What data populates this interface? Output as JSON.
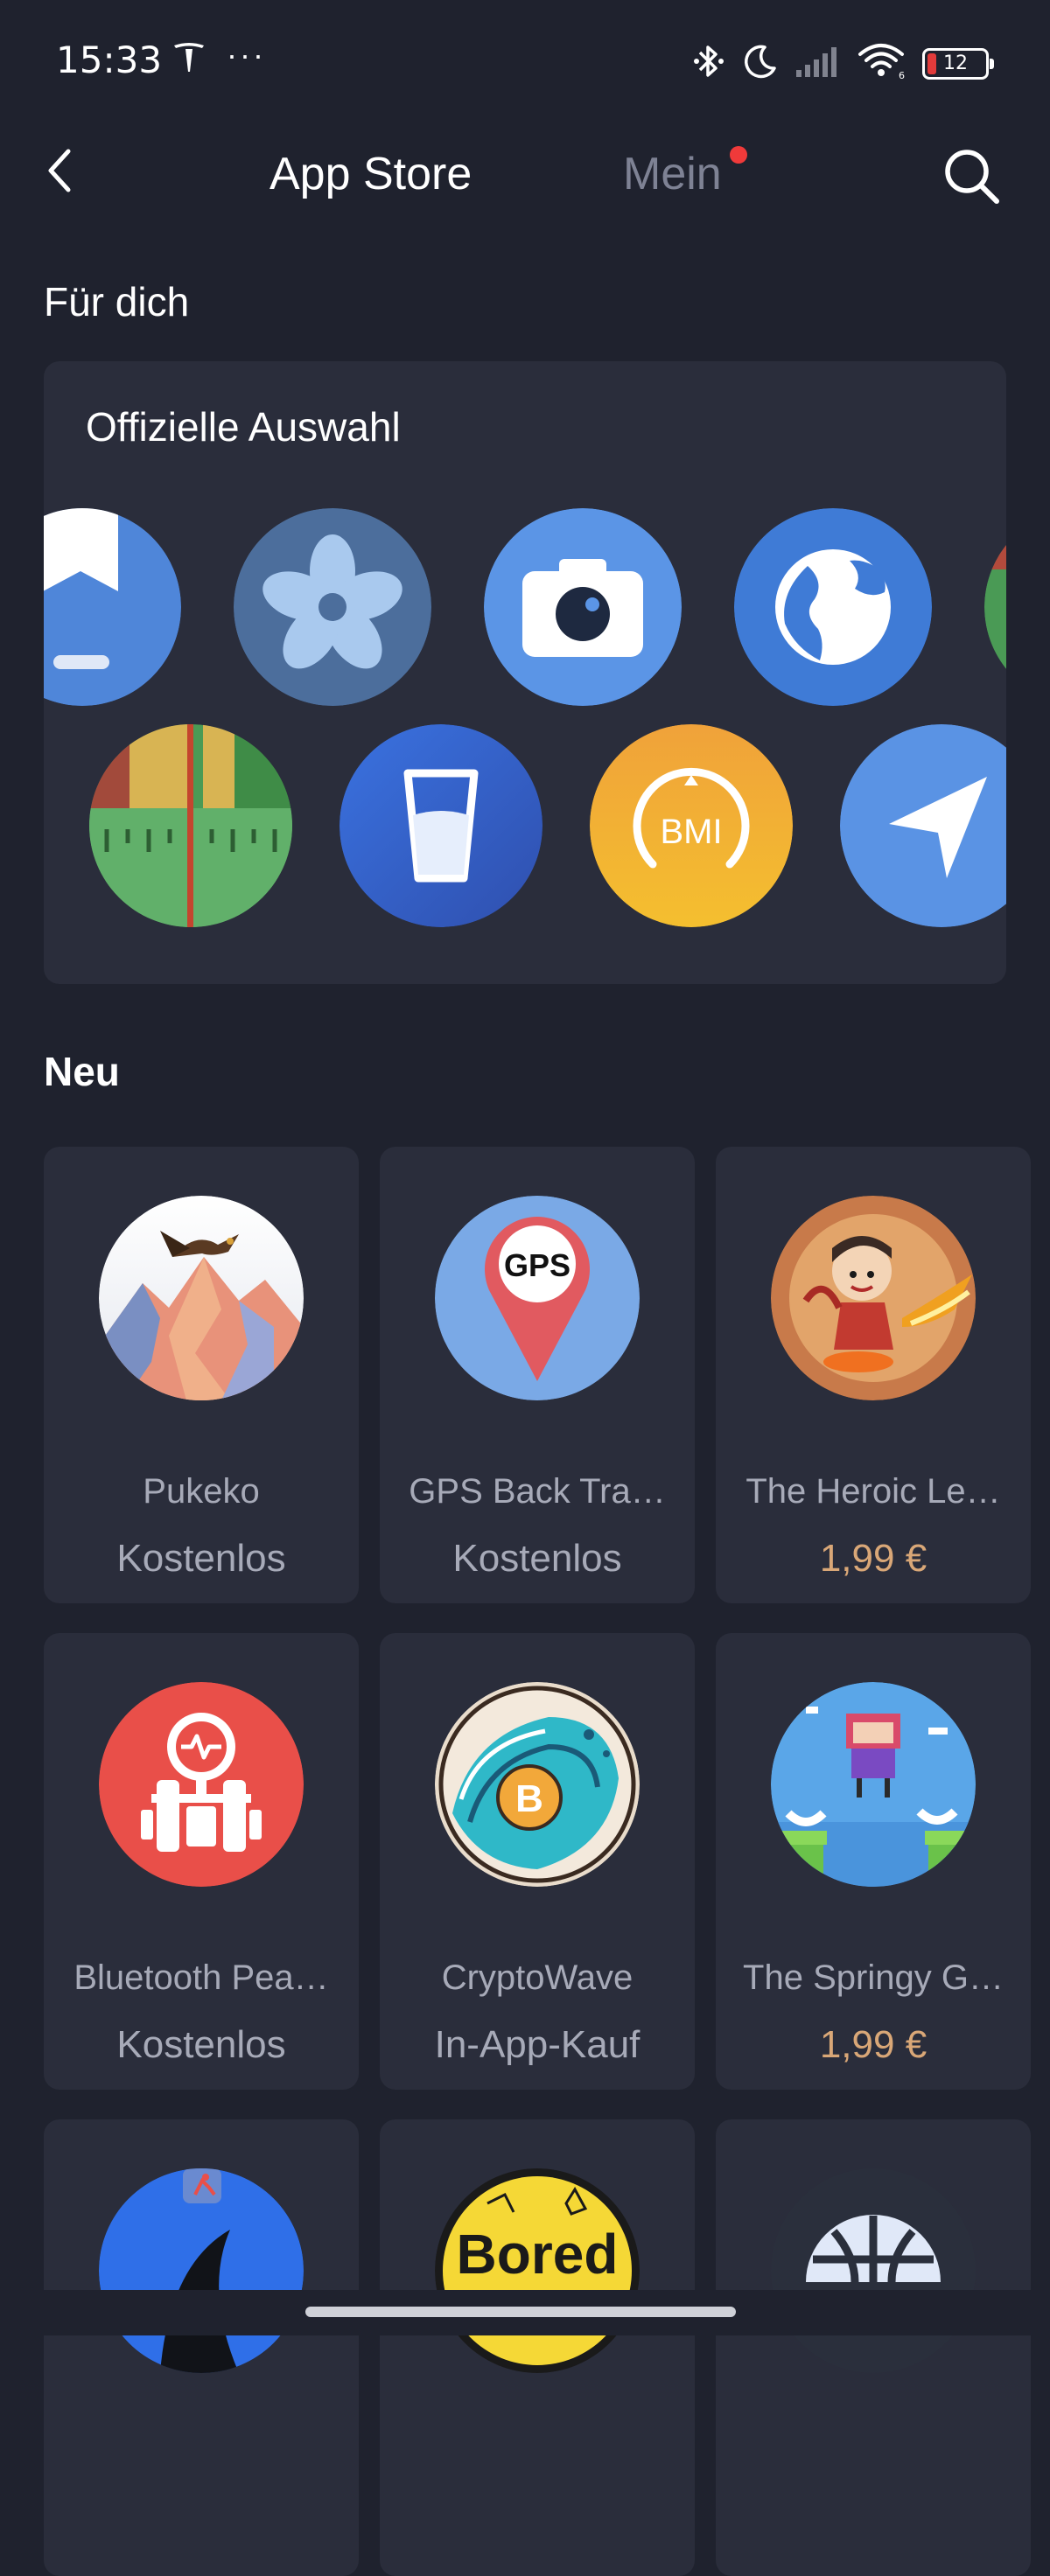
{
  "status_bar": {
    "time": "15:33",
    "battery_level": "12",
    "left_icons": [
      "tesla-icon",
      "more-dots-icon"
    ],
    "right_icons": [
      "bluetooth-icon",
      "moon-icon",
      "signal-icon",
      "wifi-icon",
      "battery-icon"
    ],
    "more_dots": "···"
  },
  "header": {
    "tab_appstore": "App Store",
    "tab_mein": "Mein",
    "mein_has_notification": true,
    "back_icon": "chevron-left-icon",
    "search_icon": "search-icon"
  },
  "for_you": {
    "heading": "Für dich",
    "card_title": "Offizielle Auswahl",
    "row1_icons": [
      "bookmark-app-icon",
      "fan-app-icon",
      "camera-app-icon",
      "globe-app-icon",
      "partial-app-icon"
    ],
    "row2_icons": [
      "ruler-app-icon",
      "water-glass-app-icon",
      "bmi-app-icon",
      "navigation-app-icon"
    ]
  },
  "new_section": {
    "heading": "Neu",
    "apps": [
      {
        "name": "Pukeko",
        "price": "Kostenlos",
        "paid": false,
        "icon": "pukeko-bird-icon"
      },
      {
        "name": "GPS Back Tra…",
        "price": "Kostenlos",
        "paid": false,
        "icon": "gps-pin-icon"
      },
      {
        "name": "The Heroic Le…",
        "price": "1,99 €",
        "paid": true,
        "icon": "heroic-legend-icon"
      },
      {
        "name": "Bluetooth Pea…",
        "price": "Kostenlos",
        "paid": false,
        "icon": "bluetooth-peak-icon"
      },
      {
        "name": "CryptoWave",
        "price": "In-App-Kauf",
        "paid": false,
        "icon": "cryptowave-icon"
      },
      {
        "name": "The Springy G…",
        "price": "1,99 €",
        "paid": true,
        "icon": "springy-game-icon"
      },
      {
        "name": "",
        "price": "",
        "paid": false,
        "icon": "shark-fin-icon"
      },
      {
        "name": "",
        "price": "",
        "paid": false,
        "icon": "bored-icon",
        "icon_text": "Bored"
      },
      {
        "name": "",
        "price": "",
        "paid": false,
        "icon": "globe-grid-icon"
      }
    ]
  },
  "colors": {
    "background": "#1f222e",
    "card": "#2a2d3b",
    "inactive_tab": "#7e8294",
    "notification_dot": "#f03a3a",
    "price_paid": "#d9a777",
    "secondary_text": "#a7aab8"
  }
}
